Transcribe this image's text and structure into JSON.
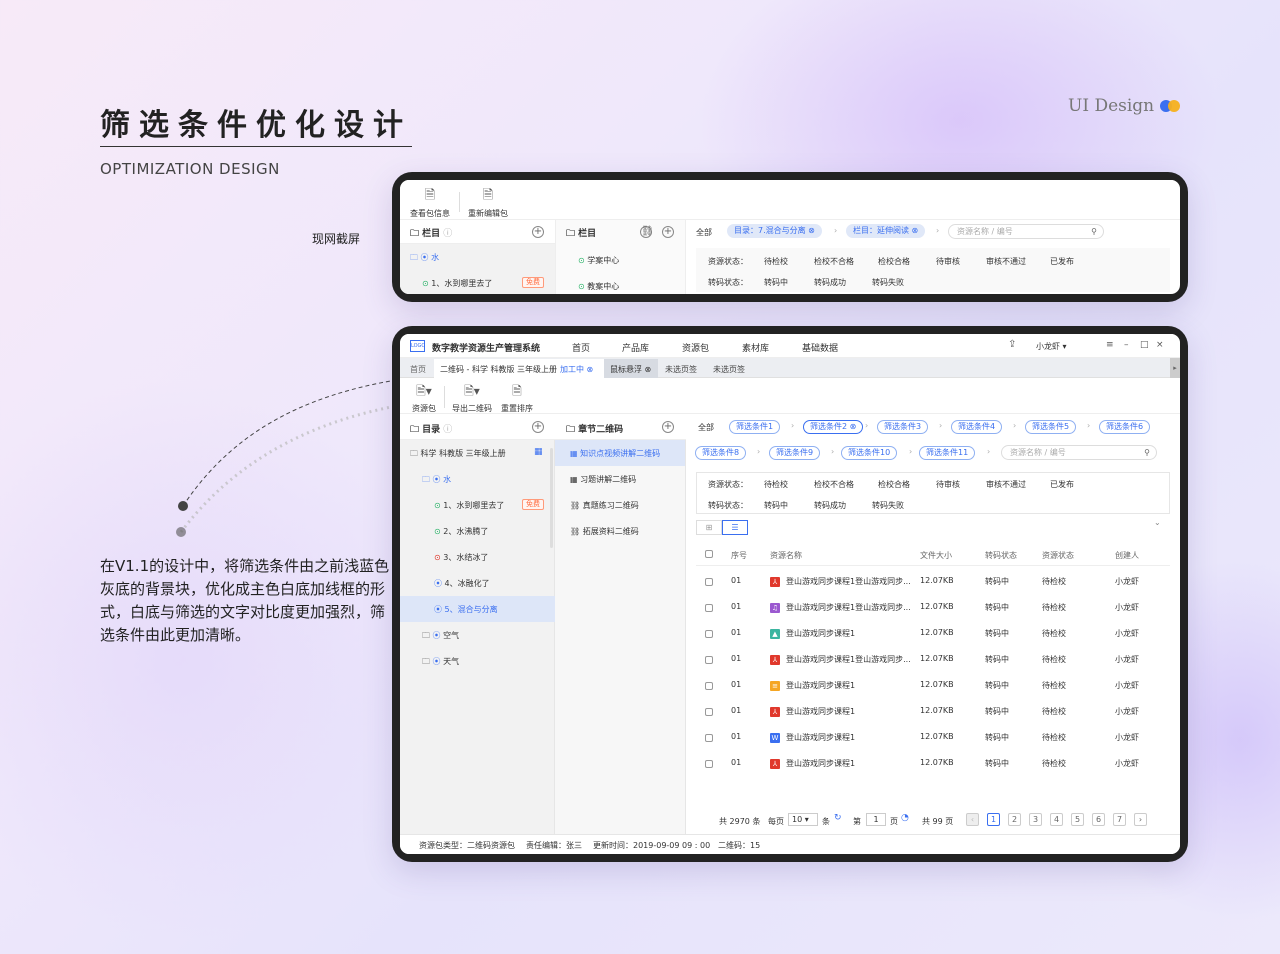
{
  "header": {
    "title": "筛选条件优化设计",
    "subtitle": "OPTIMIZATION DESIGN",
    "brand": "UI Design"
  },
  "side_label": "现网截屏",
  "description": "在V1.1的设计中，将筛选条件由之前浅蓝色灰底的背景块，优化成主色白底加线框的形式，白底与筛选的文字对比度更加强烈，筛选条件由此更加清晰。",
  "old": {
    "toolbar": [
      "查看包信息",
      "重新编辑包"
    ],
    "col1_title": "栏目",
    "col2_title": "栏目",
    "tree": [
      "水",
      "1、水到哪里去了"
    ],
    "free": "免费",
    "col2_items": [
      "学案中心",
      "教案中心"
    ],
    "all": "全部",
    "tags": [
      "目录：7.混合与分离",
      "栏目：延伸阅读"
    ],
    "search": "资源名称 / 编号",
    "status_label": "资源状态：",
    "status": [
      "待检校",
      "检校不合格",
      "检校合格",
      "待审核",
      "审核不通过",
      "已发布"
    ],
    "transcode_label": "转码状态：",
    "transcode": [
      "转码中",
      "转码成功",
      "转码失败"
    ]
  },
  "app": {
    "name": "数字教学资源生产管理系统",
    "logo": "LOGO",
    "nav": [
      "首页",
      "产品库",
      "资源包",
      "素材库",
      "基础数据"
    ],
    "user": "小龙虾",
    "tabs": [
      "首页",
      "二维码 - 科学 科教版 三年级上册",
      "加工中",
      "鼠标悬浮",
      "未选页签",
      "未选页签"
    ],
    "toolbar": [
      "资源包",
      "导出二维码",
      "重置排序"
    ],
    "col1_title": "目录",
    "col2_title": "章节二维码",
    "book": "科学 科教版 三年级上册",
    "tree": [
      "水",
      "1、水到哪里去了",
      "2、水沸腾了",
      "3、水结冰了",
      "4、冰融化了",
      "5、混合与分离",
      "空气",
      "天气"
    ],
    "free": "免费",
    "col2_items": [
      "知识点视频讲解二维码",
      "习题讲解二维码",
      "真题练习二维码",
      "拓展资料二维码"
    ],
    "all": "全部",
    "filters_row1": [
      "筛选条件1",
      "筛选条件2",
      "筛选条件3",
      "筛选条件4",
      "筛选条件5",
      "筛选条件6"
    ],
    "filters_row2": [
      "筛选条件8",
      "筛选条件9",
      "筛选条件10",
      "筛选条件11"
    ],
    "search": "资源名称 / 编号",
    "status_label": "资源状态：",
    "status": [
      "待检校",
      "检校不合格",
      "检校合格",
      "待审核",
      "审核不通过",
      "已发布"
    ],
    "transcode_label": "转码状态：",
    "transcode": [
      "转码中",
      "转码成功",
      "转码失败"
    ],
    "table": {
      "headers": [
        "序号",
        "资源名称",
        "文件大小",
        "转码状态",
        "资源状态",
        "创建人"
      ],
      "rows": [
        [
          "01",
          "登山游戏同步课程1登山游戏同步...",
          "12.07KB",
          "转码中",
          "待检校",
          "小龙虾"
        ],
        [
          "01",
          "登山游戏同步课程1登山游戏同步...",
          "12.07KB",
          "转码中",
          "待检校",
          "小龙虾"
        ],
        [
          "01",
          "登山游戏同步课程1",
          "12.07KB",
          "转码中",
          "待检校",
          "小龙虾"
        ],
        [
          "01",
          "登山游戏同步课程1登山游戏同步...",
          "12.07KB",
          "转码中",
          "待检校",
          "小龙虾"
        ],
        [
          "01",
          "登山游戏同步课程1",
          "12.07KB",
          "转码中",
          "待检校",
          "小龙虾"
        ],
        [
          "01",
          "登山游戏同步课程1",
          "12.07KB",
          "转码中",
          "待检校",
          "小龙虾"
        ],
        [
          "01",
          "登山游戏同步课程1",
          "12.07KB",
          "转码中",
          "待检校",
          "小龙虾"
        ],
        [
          "01",
          "登山游戏同步课程1",
          "12.07KB",
          "转码中",
          "待检校",
          "小龙虾"
        ]
      ],
      "file_icons": [
        "pdf",
        "audio",
        "image",
        "pdf",
        "doc",
        "pdf",
        "word",
        "pdf"
      ]
    },
    "pagination": {
      "total": "共 2970 条",
      "per_page_label": "每页",
      "per_page": "10",
      "unit": "条",
      "goto_label": "第",
      "goto": "1",
      "page_unit": "页",
      "pages_total": "共 99 页",
      "pages": [
        "1",
        "2",
        "3",
        "4",
        "5",
        "6",
        "7"
      ]
    },
    "footer": [
      "资源包类型：二维码资源包",
      "责任编辑：张三",
      "更新时间：2019-09-09 09 : 00",
      "二维码：15"
    ]
  },
  "colors": {
    "accent": "#3a6ff0",
    "free": "#ff6a3d",
    "pdf": "#e0382c",
    "audio": "#9b59d0",
    "image": "#3bb5a0",
    "doc": "#f5a623",
    "word": "#3a6ff0"
  }
}
